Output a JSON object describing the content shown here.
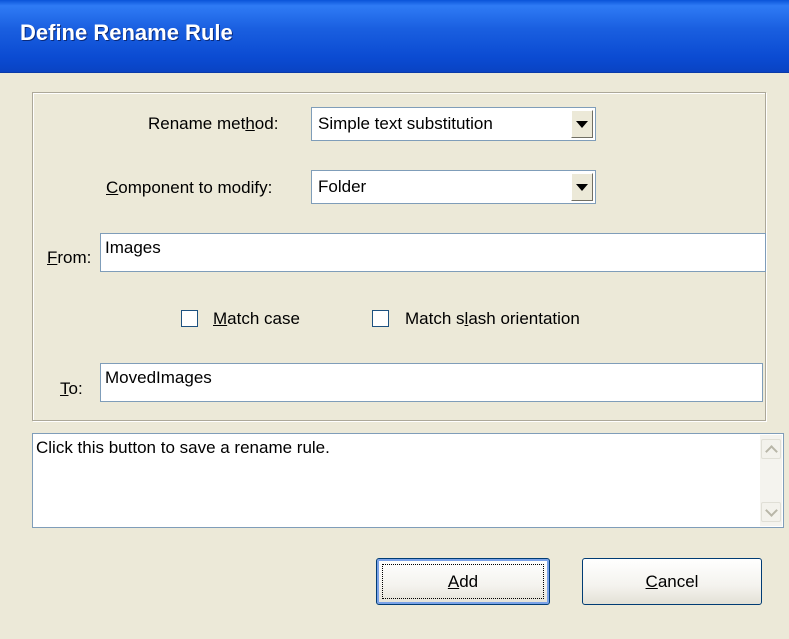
{
  "window": {
    "title": "Define Rename Rule"
  },
  "form": {
    "rename_method": {
      "label_pre": "Rename met",
      "label_key": "h",
      "label_post": "od:",
      "value": "Simple text substitution"
    },
    "component": {
      "label_pre": "",
      "label_key": "C",
      "label_post": "omponent to modify:",
      "value": "Folder"
    },
    "from": {
      "label_pre": "",
      "label_key": "F",
      "label_post": "rom:",
      "value": "Images"
    },
    "match_case": {
      "label_pre": "",
      "label_key": "M",
      "label_post": "atch case",
      "checked": false
    },
    "match_slash": {
      "label_pre": "Match s",
      "label_key": "l",
      "label_post": "ash orientation",
      "checked": false
    },
    "to": {
      "label_pre": "",
      "label_key": "T",
      "label_post": "o:",
      "value": "MovedImages"
    }
  },
  "help": {
    "text": "Click this button to save a rename rule."
  },
  "buttons": {
    "add": {
      "label_pre": "",
      "label_key": "A",
      "label_post": "dd"
    },
    "cancel": {
      "label_pre": "",
      "label_key": "C",
      "label_post": "ancel"
    }
  },
  "colors": {
    "titlebar": "#0a54d8",
    "dialog_bg": "#ece9d8",
    "field_border": "#7f9db9"
  }
}
